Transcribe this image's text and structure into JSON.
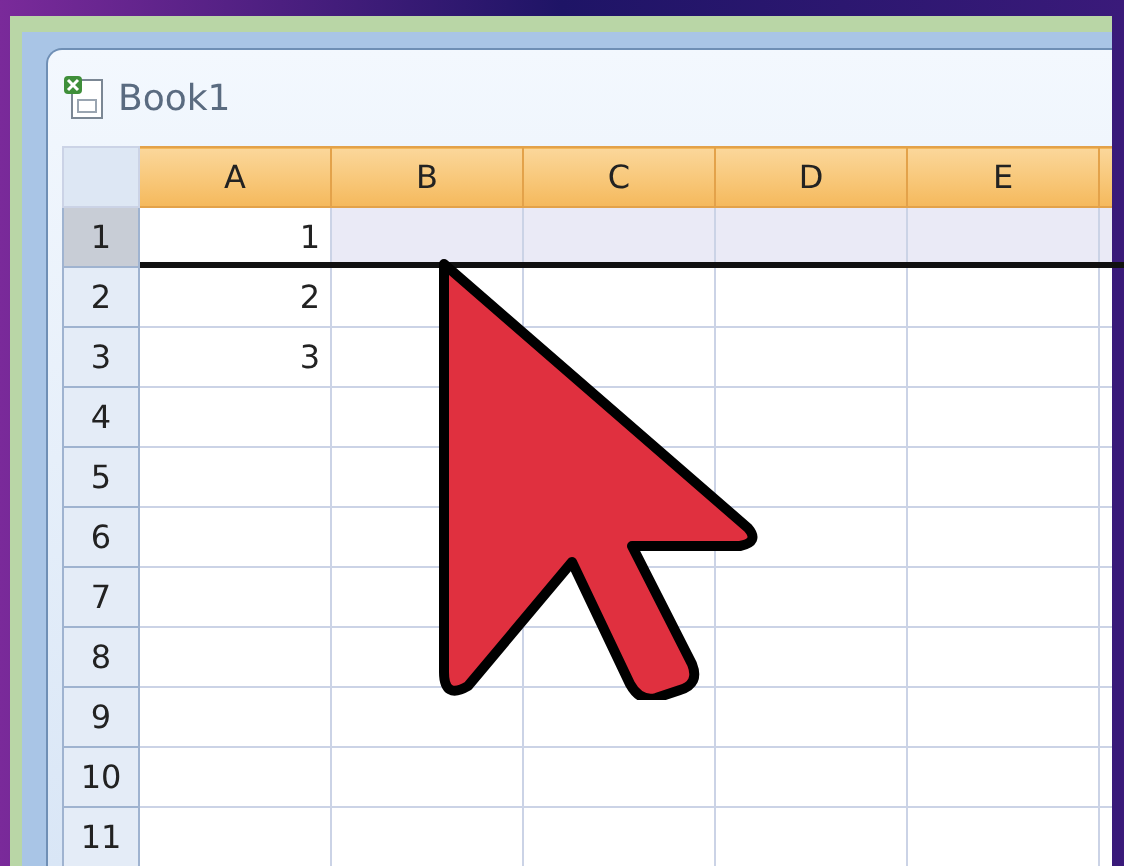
{
  "window": {
    "title": "Book1"
  },
  "columns": [
    "A",
    "B",
    "C",
    "D",
    "E"
  ],
  "rows": [
    {
      "header": "1",
      "selected": true,
      "cells": [
        "1"
      ]
    },
    {
      "header": "2",
      "selected": false,
      "cells": [
        "2"
      ]
    },
    {
      "header": "3",
      "selected": false,
      "cells": [
        "3"
      ]
    },
    {
      "header": "4",
      "selected": false
    },
    {
      "header": "5",
      "selected": false
    },
    {
      "header": "6",
      "selected": false
    },
    {
      "header": "7",
      "selected": false
    },
    {
      "header": "8",
      "selected": false
    },
    {
      "header": "9",
      "selected": false
    },
    {
      "header": "10",
      "selected": false
    },
    {
      "header": "11",
      "selected": false
    }
  ]
}
